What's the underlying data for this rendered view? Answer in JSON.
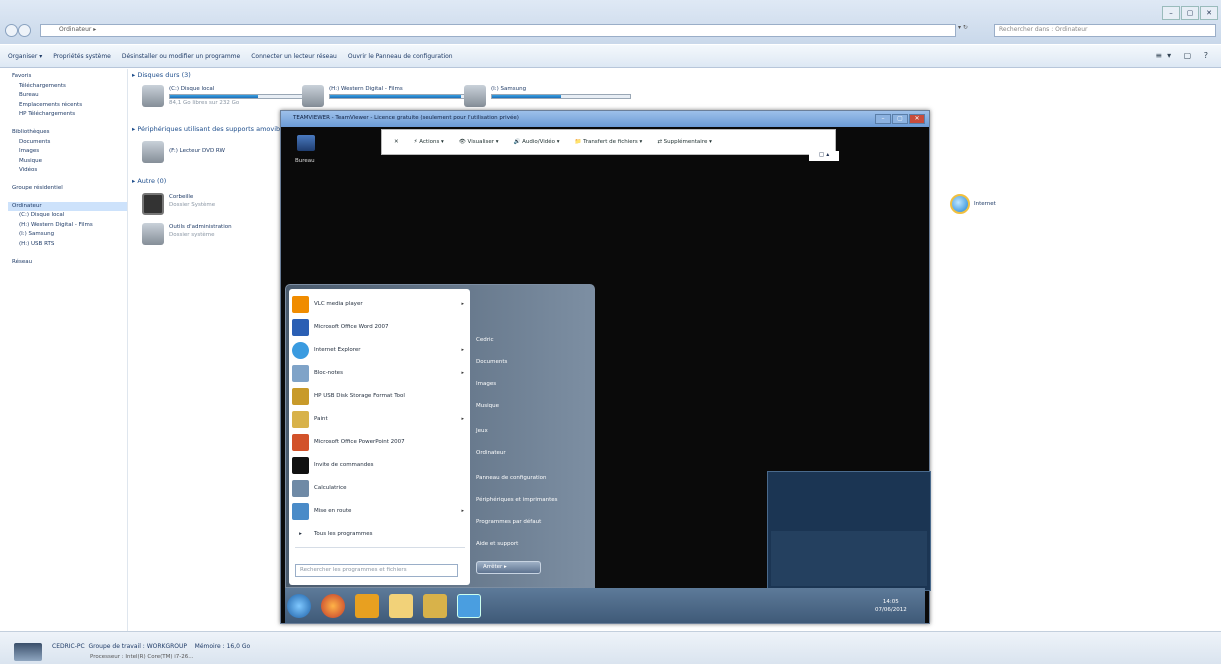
{
  "explorer": {
    "title": "Ordinateur",
    "address": "Ordinateur ▸",
    "search_placeholder": "Rechercher dans : Ordinateur",
    "win_controls": [
      "–",
      "▢",
      "✕"
    ],
    "toolbar": [
      "Organiser ▾",
      "Propriétés système",
      "Désinstaller ou modifier un programme",
      "Connecter un lecteur réseau",
      "Ouvrir le Panneau de configuration"
    ],
    "sidebar": {
      "favoris": [
        "Favoris",
        "Téléchargements",
        "Bureau",
        "Emplacements récents",
        "HP Téléchargements"
      ],
      "bibliotheques": [
        "Bibliothèques",
        "Documents",
        "Images",
        "Musique",
        "Vidéos"
      ],
      "groupe": "Groupe résidentiel",
      "ordinateur": [
        "Ordinateur",
        "(C:) Disque local",
        "(H:) Western Digital - Films",
        "(I:) Samsung",
        "(H:) USB RTS"
      ],
      "reseau": "Réseau"
    },
    "sections": {
      "disques": "▸ Disques durs (3)",
      "amovibles": "▸ Périphériques utilisant des supports amovibles (1)",
      "autre": "▸ Autre (0)"
    },
    "drives": [
      {
        "name": "(C:) Disque local",
        "free": "84,1 Go libres sur 232 Go",
        "used": 0.64
      },
      {
        "name": "(H:) Western Digital - Films",
        "free": "",
        "used": 0.95
      },
      {
        "name": "(I:) Samsung",
        "free": "",
        "used": 0.5
      }
    ],
    "dvd": {
      "name": "(F:) Lecteur DVD RW"
    },
    "others": [
      {
        "name": "Corbeille",
        "sub": "Dossier Système"
      },
      {
        "name": "Outils d'administration",
        "sub": "Dossier système"
      }
    ],
    "internet": "Internet",
    "status": {
      "pc": "CEDRIC-PC",
      "workgroup": "Groupe de travail : WORKGROUP",
      "memory": "Mémoire : 16,0 Go",
      "processor": "Processeur : Intel(R) Core(TM) i7-26..."
    }
  },
  "teamviewer": {
    "title": "TEAMVIEWER - TeamViewer - Licence gratuite (seulement pour l'utilisation privée)",
    "toolbar": [
      "✕",
      "⚡ Actions ▾",
      "👁 Visualiser ▾",
      "🔊 Audio/Vidéo ▾",
      "📁 Transfert de fichiers ▾",
      "⇄ Supplémentaire ▾"
    ],
    "toolbar_sub": "▢ ▴",
    "desktop_icon": "Bureau",
    "start_menu": {
      "programs": [
        {
          "label": "VLC media player",
          "arrow": true,
          "color": "#f08c00"
        },
        {
          "label": "Microsoft Office Word 2007",
          "arrow": false,
          "color": "#2b5fb4"
        },
        {
          "label": "Internet Explorer",
          "arrow": true,
          "color": "#3a9be0"
        },
        {
          "label": "Bloc-notes",
          "arrow": true,
          "color": "#7fa3c8"
        },
        {
          "label": "HP USB Disk Storage Format Tool",
          "arrow": false,
          "color": "#c89a2a"
        },
        {
          "label": "Paint",
          "arrow": true,
          "color": "#d8b24a"
        },
        {
          "label": "Microsoft Office PowerPoint 2007",
          "arrow": false,
          "color": "#d2522a"
        },
        {
          "label": "Invite de commandes",
          "arrow": false,
          "color": "#111111"
        },
        {
          "label": "Calculatrice",
          "arrow": false,
          "color": "#6f8aa6"
        },
        {
          "label": "Mise en route",
          "arrow": true,
          "color": "#4a8bc8"
        }
      ],
      "all_programs": "Tous les programmes",
      "search_placeholder": "Rechercher les programmes et fichiers",
      "right_items": [
        "Cedric",
        "Documents",
        "Images",
        "Musique",
        "Jeux",
        "Ordinateur",
        "Panneau de configuration",
        "Périphériques et imprimantes",
        "Programmes par défaut",
        "Aide et support"
      ],
      "shutdown": "Arrêter ▸"
    },
    "clock": {
      "time": "14:05",
      "date": "07/06/2012"
    }
  }
}
